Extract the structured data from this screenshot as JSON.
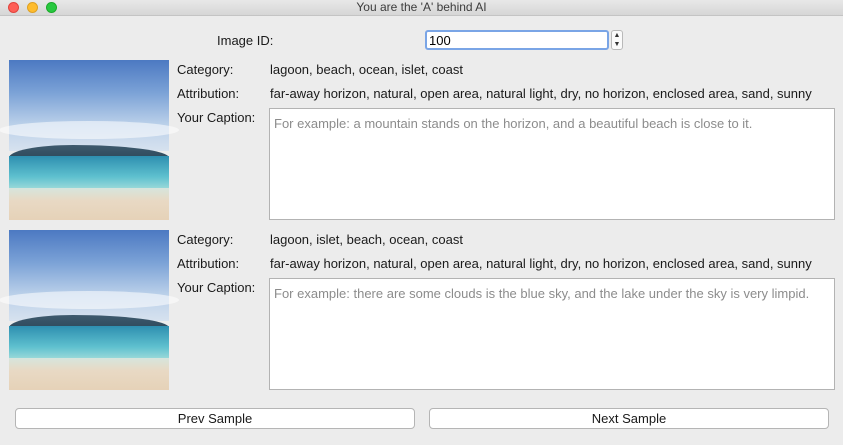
{
  "window": {
    "title": "You are the 'A' behind AI"
  },
  "image_id": {
    "label": "Image ID:",
    "value": "100"
  },
  "samples": [
    {
      "category_label": "Category:",
      "category": "lagoon, beach, ocean, islet, coast",
      "attribution_label": "Attribution:",
      "attribution": "far-away horizon, natural, open area, natural light, dry, no horizon, enclosed area, sand, sunny",
      "caption_label": "Your Caption:",
      "caption_placeholder": "For example: a mountain stands on the horizon, and a beautiful beach is close to it."
    },
    {
      "category_label": "Category:",
      "category": "lagoon, islet, beach, ocean, coast",
      "attribution_label": "Attribution:",
      "attribution": "far-away horizon, natural, open area, natural light, dry, no horizon, enclosed area, sand, sunny",
      "caption_label": "Your Caption:",
      "caption_placeholder": "For example: there are some clouds is the blue sky, and the lake under the sky is very limpid."
    }
  ],
  "buttons": {
    "prev": "Prev Sample",
    "next": "Next Sample"
  }
}
